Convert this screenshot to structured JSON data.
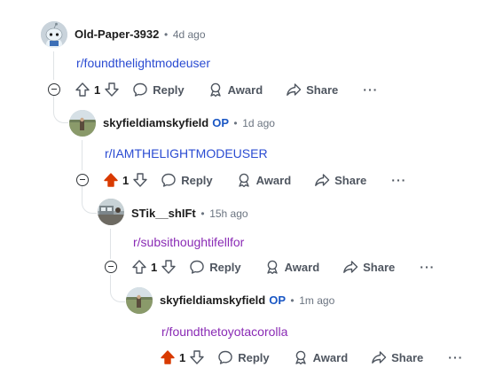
{
  "comments": [
    {
      "username": "Old-Paper-3932",
      "op": "",
      "time": "4d ago",
      "body": "r/foundthelightmodeuser",
      "votes": "1",
      "upvoted": false,
      "actions": {
        "reply": "Reply",
        "award": "Award",
        "share": "Share",
        "more": "···"
      }
    },
    {
      "username": "skyfieldiamskyfield",
      "op": "OP",
      "time": "1d ago",
      "body": "r/IAMTHELIGHTMODEUSER",
      "votes": "1",
      "upvoted": true,
      "actions": {
        "reply": "Reply",
        "award": "Award",
        "share": "Share",
        "more": "···"
      }
    },
    {
      "username": "STik__shIFt",
      "op": "",
      "time": "15h ago",
      "body": "r/subsithoughtifellfor",
      "votes": "1",
      "upvoted": false,
      "actions": {
        "reply": "Reply",
        "award": "Award",
        "share": "Share",
        "more": "···"
      }
    },
    {
      "username": "skyfieldiamskyfield",
      "op": "OP",
      "time": "1m ago",
      "body": "r/foundthetoyotacorolla",
      "votes": "1",
      "upvoted": true,
      "actions": {
        "reply": "Reply",
        "award": "Award",
        "share": "Share",
        "more": "···"
      }
    }
  ],
  "colors": {
    "upvote_active": "#d93a00",
    "link_blue": "#2a4bd2",
    "link_visited": "#8a2bb5",
    "op_blue": "#1a57c4"
  }
}
